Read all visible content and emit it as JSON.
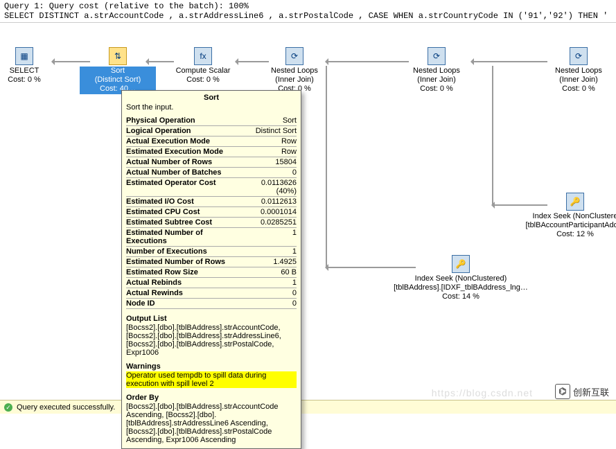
{
  "header": {
    "line1": "Query 1: Query cost (relative to the batch): 100%",
    "line2": "SELECT DISTINCT a.strAccountCode , a.strAddressLine6 , a.strPostalCode , CASE WHEN a.strCountryCode IN ('91','92') THEN '"
  },
  "nodes": {
    "select": {
      "title": "SELECT",
      "cost": "Cost: 0 %"
    },
    "sort": {
      "title": "Sort",
      "sub": "(Distinct Sort)",
      "cost": "Cost: 40…"
    },
    "compute": {
      "title": "Compute Scalar",
      "cost": "Cost: 0 %"
    },
    "nl1": {
      "title": "Nested Loops",
      "sub": "(Inner Join)",
      "cost": "Cost: 0 %"
    },
    "nl2": {
      "title": "Nested Loops",
      "sub": "(Inner Join)",
      "cost": "Cost: 0 %"
    },
    "nl3": {
      "title": "Nested Loops",
      "sub": "(Inner Join)",
      "cost": "Cost: 0 %"
    },
    "seek_addr": {
      "title": "Index Seek (NonClustered)",
      "obj": "[tblBAddress].[IDXF_tblBAddress_lng…",
      "cost": "Cost: 14 %"
    },
    "seek_part": {
      "title": "Index Seek (NonClustere",
      "obj": "[tblBAccountParticipantAddre",
      "cost": "Cost: 12 %"
    }
  },
  "tooltip": {
    "title": "Sort",
    "desc": "Sort the input.",
    "props": [
      {
        "k": "Physical Operation",
        "v": "Sort"
      },
      {
        "k": "Logical Operation",
        "v": "Distinct Sort"
      },
      {
        "k": "Actual Execution Mode",
        "v": "Row"
      },
      {
        "k": "Estimated Execution Mode",
        "v": "Row"
      },
      {
        "k": "Actual Number of Rows",
        "v": "15804"
      },
      {
        "k": "Actual Number of Batches",
        "v": "0"
      },
      {
        "k": "Estimated Operator Cost",
        "v": "0.0113626 (40%)"
      },
      {
        "k": "Estimated I/O Cost",
        "v": "0.0112613"
      },
      {
        "k": "Estimated CPU Cost",
        "v": "0.0001014"
      },
      {
        "k": "Estimated Subtree Cost",
        "v": "0.0285251"
      },
      {
        "k": "Estimated Number of Executions",
        "v": "1"
      },
      {
        "k": "Number of Executions",
        "v": "1"
      },
      {
        "k": "Estimated Number of Rows",
        "v": "1.4925"
      },
      {
        "k": "Estimated Row Size",
        "v": "60 B"
      },
      {
        "k": "Actual Rebinds",
        "v": "1"
      },
      {
        "k": "Actual Rewinds",
        "v": "0"
      },
      {
        "k": "Node ID",
        "v": "0"
      }
    ],
    "output_list_h": "Output List",
    "output_list": "[Bocss2].[dbo].[tblBAddress].strAccountCode, [Bocss2].[dbo].[tblBAddress].strAddressLine6, [Bocss2].[dbo].[tblBAddress].strPostalCode, Expr1006",
    "warnings_h": "Warnings",
    "warnings": "Operator used tempdb to spill data during execution with spill level 2",
    "orderby_h": "Order By",
    "orderby": "[Bocss2].[dbo].[tblBAddress].strAccountCode Ascending, [Bocss2].[dbo].[tblBAddress].strAddressLine6 Ascending, [Bocss2].[dbo].[tblBAddress].strPostalCode Ascending, Expr1006 Ascending"
  },
  "status": {
    "msg": "Query executed successfully."
  },
  "watermark": {
    "text": "创新互联",
    "url": "https://blog.csdn.net"
  }
}
